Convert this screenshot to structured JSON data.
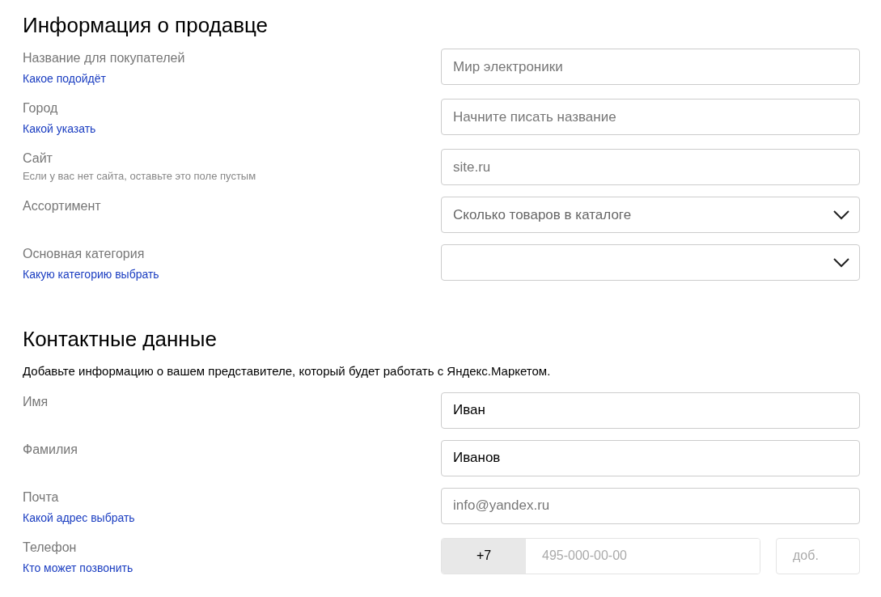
{
  "sections": [
    {
      "title": "Информация о продавце",
      "fields": [
        {
          "kind": "text",
          "label": "Название для покупателей",
          "hint": {
            "kind": "link",
            "text": "Какое подойдёт"
          },
          "placeholder": "Мир электроники"
        },
        {
          "kind": "text",
          "label": "Город",
          "hint": {
            "kind": "link",
            "text": "Какой указать"
          },
          "placeholder": "Начните писать название"
        },
        {
          "kind": "text",
          "label": "Сайт",
          "hint": {
            "kind": "note",
            "text": "Если у вас нет сайта, оставьте это поле пустым"
          },
          "placeholder": "site.ru"
        },
        {
          "kind": "select",
          "label": "Ассортимент",
          "placeholder": "Сколько товаров в каталоге"
        },
        {
          "kind": "select",
          "label": "Основная категория",
          "hint": {
            "kind": "link",
            "text": "Какую категорию выбрать"
          }
        }
      ]
    },
    {
      "title": "Контактные данные",
      "description": "Добавьте информацию о вашем представителе, который будет работать с Яндекс.Маркетом.",
      "fields": [
        {
          "kind": "text",
          "label": "Имя",
          "value": "Иван"
        },
        {
          "kind": "text",
          "label": "Фамилия",
          "value": "Иванов"
        },
        {
          "kind": "text",
          "label": "Почта",
          "hint": {
            "kind": "link",
            "text": "Какой адрес выбрать"
          },
          "placeholder": "info@yandex.ru"
        },
        {
          "kind": "phone",
          "label": "Телефон",
          "hint": {
            "kind": "link",
            "text": "Кто может позвонить"
          },
          "prefix": "+7",
          "placeholder": "495-000-00-00",
          "extension_placeholder": "доб."
        }
      ]
    }
  ]
}
